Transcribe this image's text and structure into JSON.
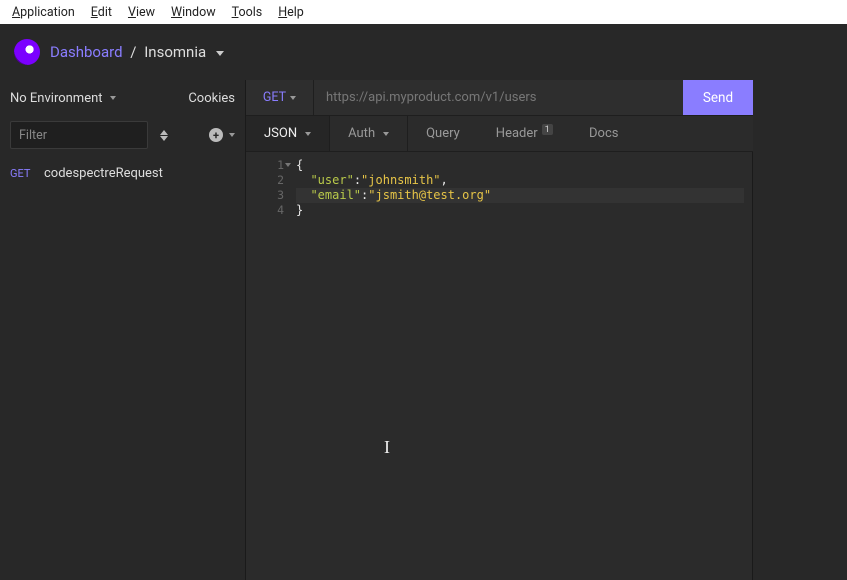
{
  "menubar": {
    "items": [
      "Application",
      "Edit",
      "View",
      "Window",
      "Tools",
      "Help"
    ]
  },
  "breadcrumb": {
    "dashboard": "Dashboard",
    "sep": "/",
    "workspace": "Insomnia"
  },
  "sidebar": {
    "env_label": "No Environment",
    "cookies_label": "Cookies",
    "filter_placeholder": "Filter",
    "requests": [
      {
        "method": "GET",
        "name": "codespectreRequest"
      }
    ]
  },
  "urlbar": {
    "method": "GET",
    "url": "https://api.myproduct.com/v1/users",
    "send_label": "Send"
  },
  "tabs": {
    "body_label": "JSON",
    "auth_label": "Auth",
    "query_label": "Query",
    "header_label": "Header",
    "header_badge": "1",
    "docs_label": "Docs"
  },
  "editor": {
    "lines": [
      {
        "n": 1,
        "raw": "{"
      },
      {
        "n": 2,
        "raw": "  \"user\":\"johnsmith\","
      },
      {
        "n": 3,
        "raw": "  \"email\":\"jsmith@test.org\""
      },
      {
        "n": 4,
        "raw": "}"
      }
    ],
    "json_value": {
      "user": "johnsmith",
      "email": "jsmith@test.org"
    },
    "cursor_glyph": "I"
  }
}
